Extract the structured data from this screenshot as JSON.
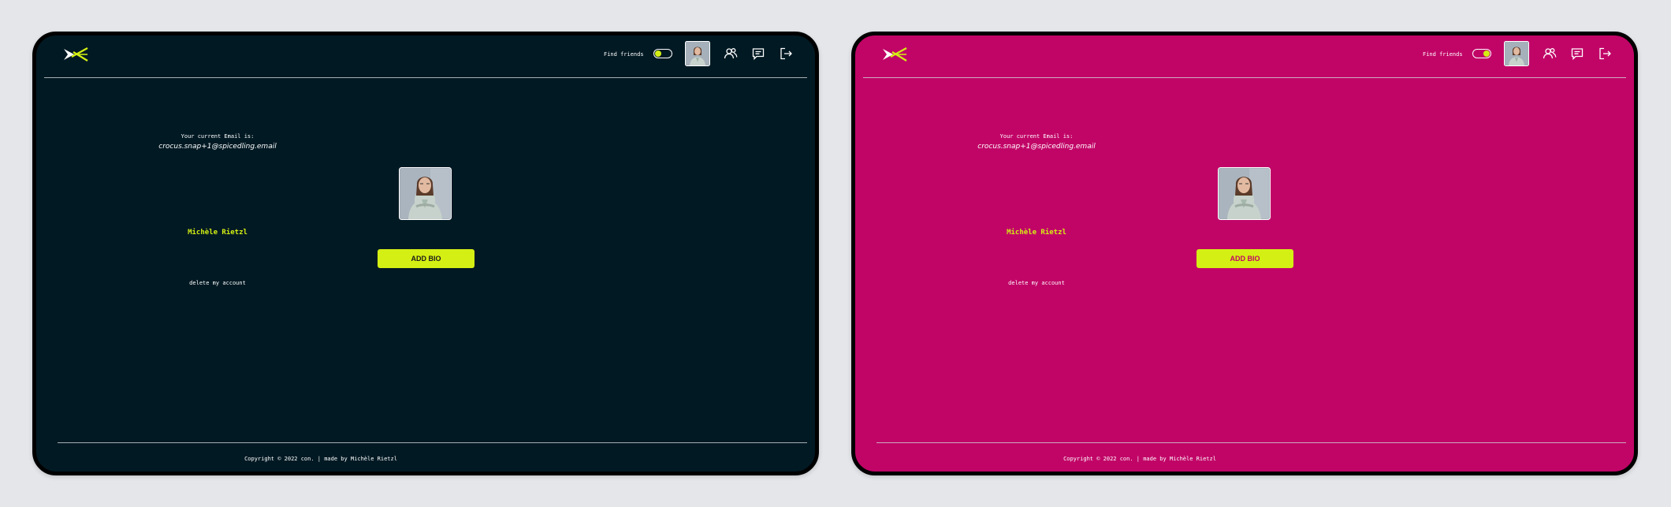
{
  "nav": {
    "find_friends_label": "Find friends",
    "icons": [
      "logo-icon",
      "friends-icon",
      "chat-icon",
      "logout-icon"
    ]
  },
  "profile": {
    "email_label": "Your current Email is:",
    "email": "crocus.snap+1@spicedling.email",
    "name": "Michèle Rietzl",
    "add_bio_label": "ADD BIO",
    "delete_label": "delete my account"
  },
  "footer": {
    "copyright": "Copyright © 2022 con. | made by Michèle Rietzl"
  },
  "themes": {
    "dark": {
      "background": "#011923",
      "accent": "#d4ef13",
      "toggle": "off"
    },
    "pink": {
      "background": "#c10567",
      "accent": "#d4ef13",
      "toggle": "on"
    }
  }
}
